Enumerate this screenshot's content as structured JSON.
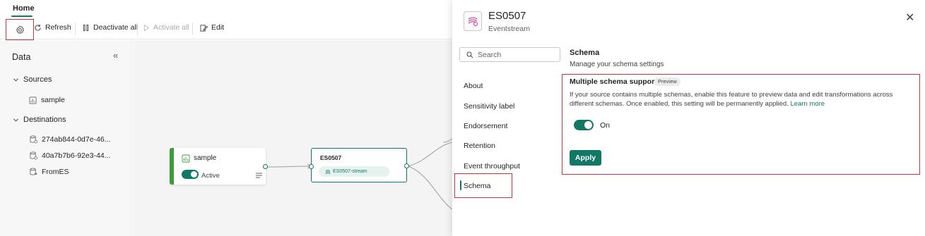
{
  "tabs": {
    "home": "Home"
  },
  "toolbar": {
    "refresh": "Refresh",
    "deactivate_all": "Deactivate all",
    "activate_all": "Activate all",
    "edit": "Edit"
  },
  "data_pane": {
    "title": "Data",
    "sources_label": "Sources",
    "sources": [
      "sample"
    ],
    "destinations_label": "Destinations",
    "destinations": [
      "274ab844-0d7e-46...",
      "40a7b7b6-92e3-44...",
      "FromES"
    ]
  },
  "canvas": {
    "source_node": {
      "name": "sample",
      "status": "Active"
    },
    "eventstream_node": {
      "name": "ES0507",
      "stream": "ES0507-stream"
    }
  },
  "panel": {
    "title": "ES0507",
    "subtitle": "Eventstream",
    "search_placeholder": "Search",
    "nav": [
      "About",
      "Sensitivity label",
      "Endorsement",
      "Retention",
      "Event throughput",
      "Schema"
    ],
    "section_title": "Schema",
    "section_subtitle": "Manage your schema settings",
    "option_title": "Multiple schema support",
    "option_badge": "Preview",
    "option_description": "If your source contains multiple schemas, enable this feature to preview data and edit transformations across different schemas. Once enabled, this setting will be permanently applied.",
    "learn_more": "Learn more",
    "toggle_state": "On",
    "apply": "Apply"
  },
  "colors": {
    "accent": "#117865",
    "highlight": "#d13438",
    "source_bar": "#3e9a3a"
  }
}
